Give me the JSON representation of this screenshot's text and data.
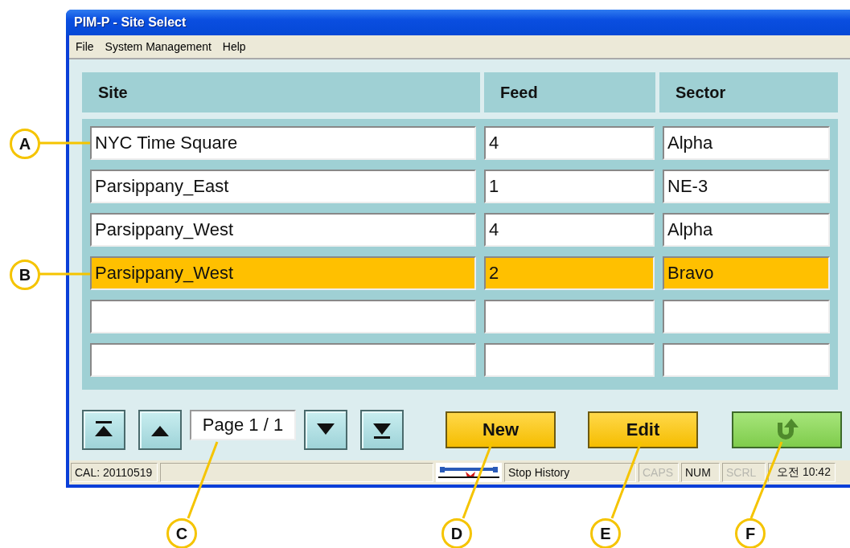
{
  "window": {
    "title": "PIM-P - Site Select"
  },
  "menu": [
    "File",
    "System Management",
    "Help"
  ],
  "table": {
    "columns": [
      "Site",
      "Feed",
      "Sector"
    ],
    "rows": [
      {
        "selected": false,
        "cells": [
          "NYC Time Square",
          "4",
          "Alpha"
        ]
      },
      {
        "selected": false,
        "cells": [
          "Parsippany_East",
          "1",
          "NE-3"
        ]
      },
      {
        "selected": false,
        "cells": [
          "Parsippany_West",
          "4",
          "Alpha"
        ]
      },
      {
        "selected": true,
        "cells": [
          "Parsippany_West",
          "2",
          "Bravo"
        ]
      },
      {
        "selected": false
      },
      {
        "selected": false
      }
    ]
  },
  "pager": {
    "page": "Page 1 / 1"
  },
  "buttons": [
    {
      "kind": "text",
      "label": "New"
    },
    {
      "kind": "text",
      "label": "Edit"
    },
    {
      "kind": "return"
    }
  ],
  "status_bar": {
    "cal": "CAL: 20110519",
    "history": "Stop History",
    "indicators": [
      {
        "label": "CAPS",
        "on": false
      },
      {
        "label": "NUM",
        "on": true
      },
      {
        "label": "SCRL",
        "on": false
      }
    ],
    "clock": "오전 10:42"
  },
  "callouts": [
    "A",
    "B",
    "C",
    "D",
    "E",
    "F"
  ]
}
